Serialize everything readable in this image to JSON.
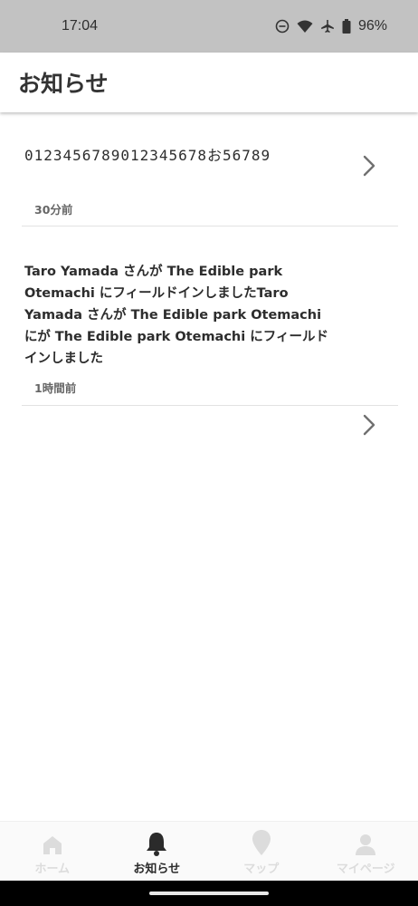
{
  "status_bar": {
    "time": "17:04",
    "battery": "96%",
    "icons": [
      "dnd-icon",
      "wifi-icon",
      "airplane-icon",
      "battery-icon"
    ]
  },
  "header": {
    "title": "お知らせ"
  },
  "notifications": [
    {
      "title": "0123456789012345678お56789",
      "time": "30分前"
    },
    {
      "title": "Taro Yamada さんが The Edible park Otemachi にフィールドインしましたTaro Yamada さんが The Edible park Otemachi にが The Edible park Otemachi にフィールドインしました",
      "time": "1時間前"
    }
  ],
  "tabs": [
    {
      "label": "ホーム",
      "icon": "home-icon",
      "active": false
    },
    {
      "label": "お知らせ",
      "icon": "bell-icon",
      "active": true
    },
    {
      "label": "マップ",
      "icon": "map-pin-icon",
      "active": false
    },
    {
      "label": "マイページ",
      "icon": "person-icon",
      "active": false
    }
  ],
  "colors": {
    "status_bar_bg": "#c2c2c2",
    "active_tab": "#2b2b2b",
    "inactive_tab": "#dcdcdc",
    "chevron": "#707070"
  }
}
